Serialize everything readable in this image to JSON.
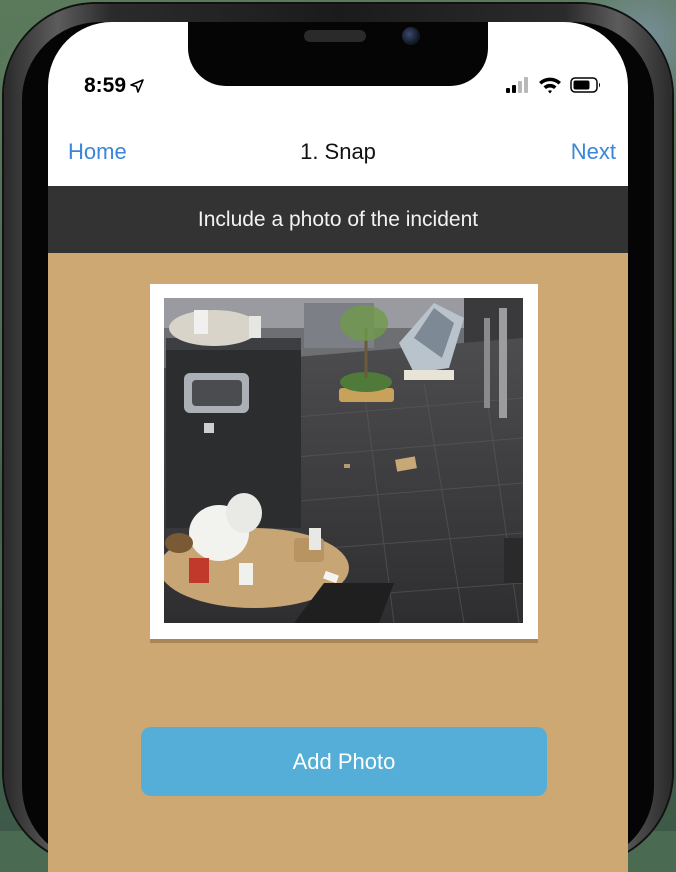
{
  "status_bar": {
    "time": "8:59",
    "location_icon": "location-arrow-icon",
    "signal_icon": "cellular-signal-icon",
    "wifi_icon": "wifi-icon",
    "battery_icon": "battery-icon"
  },
  "nav": {
    "home_label": "Home",
    "title": "1. Snap",
    "next_label": "Next"
  },
  "instruction": {
    "text": "Include a photo of the incident"
  },
  "photo": {
    "subject": "overflowing public trash bin with litter on a plaza at night"
  },
  "actions": {
    "add_photo_label": "Add Photo"
  },
  "colors": {
    "accent_link": "#3a86d8",
    "instruction_bg": "#333333",
    "content_bg": "#cda873",
    "button_bg": "#55aed7"
  }
}
